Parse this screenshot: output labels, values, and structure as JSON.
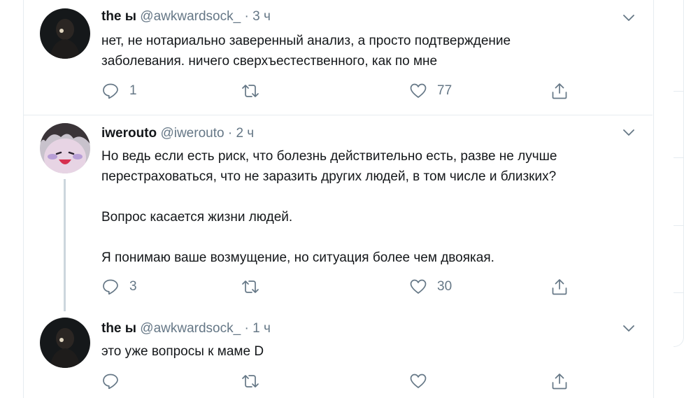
{
  "tweets": [
    {
      "name": "the ы",
      "handle": "@awkwardsock_",
      "separator": "·",
      "time": "3 ч",
      "text": "нет, не нотариально заверенный анализ, а просто подтверждение\nзаболевания. ничего сверхъестественного, как по мне",
      "replies": "1",
      "retweets": "",
      "likes": "77"
    },
    {
      "name": "iwerouto",
      "handle": "@iwerouto",
      "separator": "·",
      "time": "2 ч",
      "text": "Но ведь если есть риск, что болезнь действительно есть, разве не лучше\nперестраховаться, что не заразить других людей, в том числе и близких?\n\nВопрос касается жизни людей.\n\nЯ понимаю ваше возмущение, но ситуация более чем двоякая.",
      "replies": "3",
      "retweets": "",
      "likes": "30"
    },
    {
      "name": "the ы",
      "handle": "@awkwardsock_",
      "separator": "·",
      "time": "1 ч",
      "text": "это уже вопросы к маме D",
      "replies": "",
      "retweets": "",
      "likes": ""
    }
  ],
  "icons": {
    "reply": "reply-icon",
    "retweet": "retweet-icon",
    "like": "heart-icon",
    "share": "share-icon",
    "more": "chevron-down-icon"
  },
  "colors": {
    "text": "#14171a",
    "secondary": "#657786",
    "border": "#e6ecf0",
    "thread_line": "#ccd6dd"
  }
}
